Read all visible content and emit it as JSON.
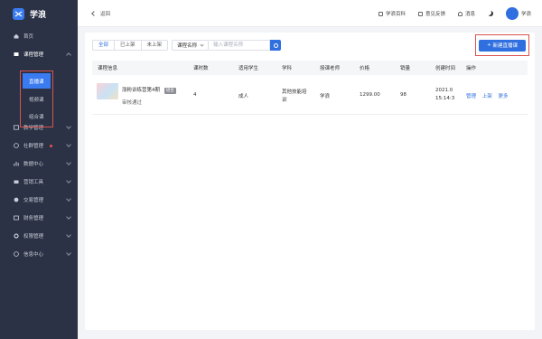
{
  "app": {
    "name": "学浪"
  },
  "sidebar": {
    "items": [
      {
        "label": "首页"
      },
      {
        "label": "课程管理"
      },
      {
        "label": "教学管理"
      },
      {
        "label": "社群管理"
      },
      {
        "label": "数据中心"
      },
      {
        "label": "营销工具"
      },
      {
        "label": "交易管理"
      },
      {
        "label": "财务管理"
      },
      {
        "label": "权限管理"
      },
      {
        "label": "信息中心"
      }
    ],
    "sub_items": [
      {
        "label": "直播课"
      },
      {
        "label": "视频课"
      },
      {
        "label": "组合课"
      }
    ]
  },
  "topbar": {
    "back": "返回",
    "links": [
      "学浪百科",
      "意见反馈",
      "消息"
    ],
    "user": "学浪"
  },
  "filters": {
    "status_tabs": [
      "全部",
      "已上架",
      "未上架"
    ],
    "select": "课程名称",
    "search_placeholder": "输入课程名称"
  },
  "new_button": "新建直播课",
  "table": {
    "headers": [
      "课程信息",
      "课时数",
      "适用学生",
      "学科",
      "授课老师",
      "价格",
      "销量",
      "创建时间",
      "操作"
    ],
    "rows": [
      {
        "title": "涨粉训练营第4期",
        "tag": "组合",
        "status": "审核通过",
        "lessons": "4",
        "students": "成人",
        "subject_line1": "其他技能培",
        "subject_line2": "训",
        "teacher": "学浪",
        "price": "1299.00",
        "sales": "98",
        "created_line1": "2021.0",
        "created_line2": "15:14:3",
        "actions": [
          "管理",
          "上架",
          "更多"
        ]
      }
    ]
  },
  "colors": {
    "sidebar": "#2b3245",
    "accent": "#2f6fe0",
    "highlight_border": "#d9534f"
  }
}
